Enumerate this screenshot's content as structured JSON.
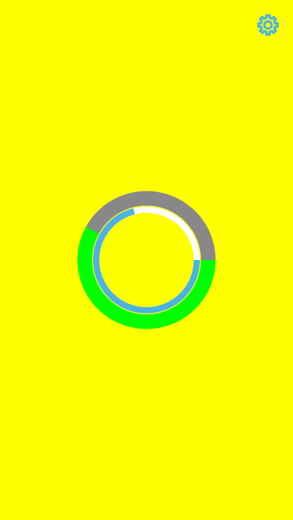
{
  "theme": {
    "background": "#FFFF00",
    "accent": "#4AB3E6"
  },
  "header": {
    "settings_icon": "gear-icon"
  },
  "timer_ring": {
    "outer_track_color": "#888888",
    "outer_progress_color": "#00FF00",
    "outer_progress_fraction": 0.58,
    "inner_track_color": "#FFFFFF",
    "inner_progress_color": "#4AB3E6",
    "inner_progress_fraction": 0.71
  }
}
